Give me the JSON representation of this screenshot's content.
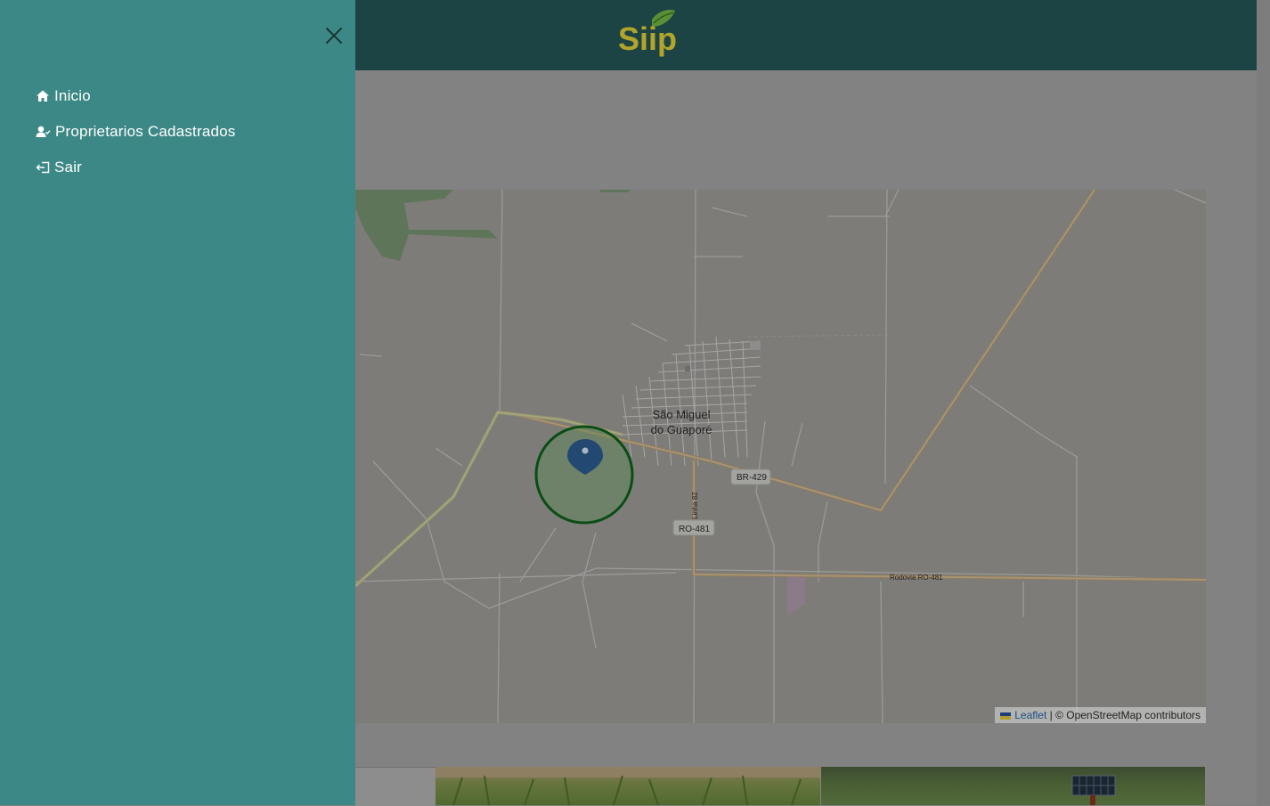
{
  "sidebar": {
    "items": [
      {
        "label": "Inicio",
        "icon": "home-icon"
      },
      {
        "label": "Proprietarios Cadastrados",
        "icon": "user-check-icon"
      },
      {
        "label": "Sair",
        "icon": "logout-icon"
      }
    ]
  },
  "header": {
    "logo_text": "Siip",
    "background": "#1d4445"
  },
  "map": {
    "city_label_line1": "São Miguel",
    "city_label_line2": "do Guaporé",
    "road_labels": [
      "BR-429",
      "RO-481",
      "Linha 82",
      "Rodovia RO-481"
    ],
    "attribution_link": "Leaflet",
    "attribution_text": "| © OpenStreetMap contributors"
  },
  "colors": {
    "sidebar": "#3c8886",
    "overlay": "#808080",
    "circle": "#0a5a14"
  }
}
